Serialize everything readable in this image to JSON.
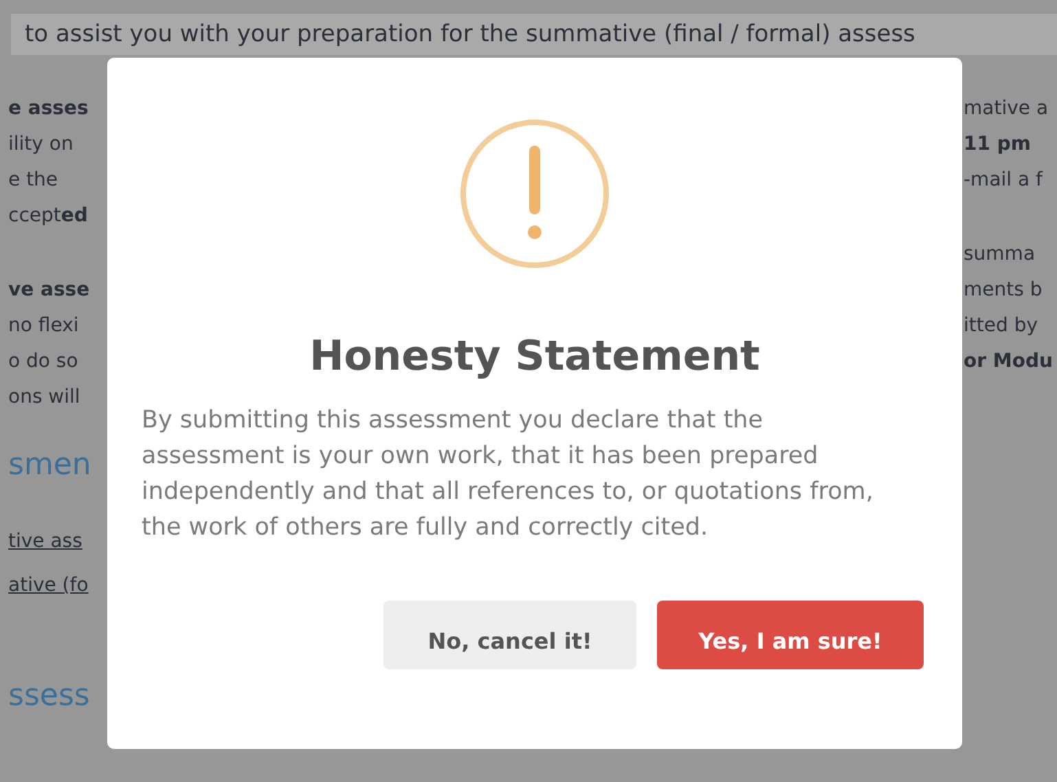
{
  "page": {
    "top_line": "to assist you with your preparation for the summative (final / formal) assess",
    "left_blocks": [
      {
        "kind": "paragraph",
        "lines": [
          {
            "text": "e asses",
            "kind": "bold"
          },
          {
            "text": "ility on",
            "kind": "plain"
          },
          {
            "text": "e the",
            "kind": "plain"
          },
          {
            "text": "ccept**ed**",
            "kind": "plain"
          }
        ]
      },
      {
        "kind": "paragraph",
        "lines": [
          {
            "text": "ve asse",
            "kind": "bold"
          },
          {
            "text": "no flexi",
            "kind": "plain"
          },
          {
            "text": "o do so",
            "kind": "plain"
          },
          {
            "text": "ons will",
            "kind": "plain"
          }
        ]
      },
      {
        "kind": "heading",
        "lines": [
          {
            "text": "smen",
            "kind": "plain"
          }
        ]
      },
      {
        "kind": "links",
        "lines": [
          {
            "text": "tive ass",
            "kind": "plain"
          },
          {
            "text": "ative (fo",
            "kind": "plain"
          }
        ]
      },
      {
        "kind": "heading",
        "lines": [
          {
            "text": "ssess",
            "kind": "plain"
          }
        ]
      }
    ],
    "right_blocks": [
      {
        "lines": [
          {
            "text": "mative a",
            "kind": "plain"
          },
          {
            "text": "11 pm",
            "kind": "bold"
          },
          {
            "text": "-mail a f",
            "kind": "plain"
          }
        ]
      },
      {
        "lines": [
          {
            "text": "summa",
            "kind": "plain"
          },
          {
            "text": "ments b",
            "kind": "plain"
          },
          {
            "text": "itted by",
            "kind": "plain"
          },
          {
            "text": "or Modu",
            "kind": "bold"
          }
        ]
      }
    ]
  },
  "dialog": {
    "title": "Honesty Statement",
    "message": "By submitting this assessment you declare that the assessment is your own work, that it has been prepared independently and that all references to, or quotations from, the work of others are fully and correctly cited.",
    "buttons": [
      {
        "label": "No, cancel it!",
        "kind": "cancel"
      },
      {
        "label": "Yes, I am sure!",
        "kind": "confirm"
      }
    ]
  }
}
